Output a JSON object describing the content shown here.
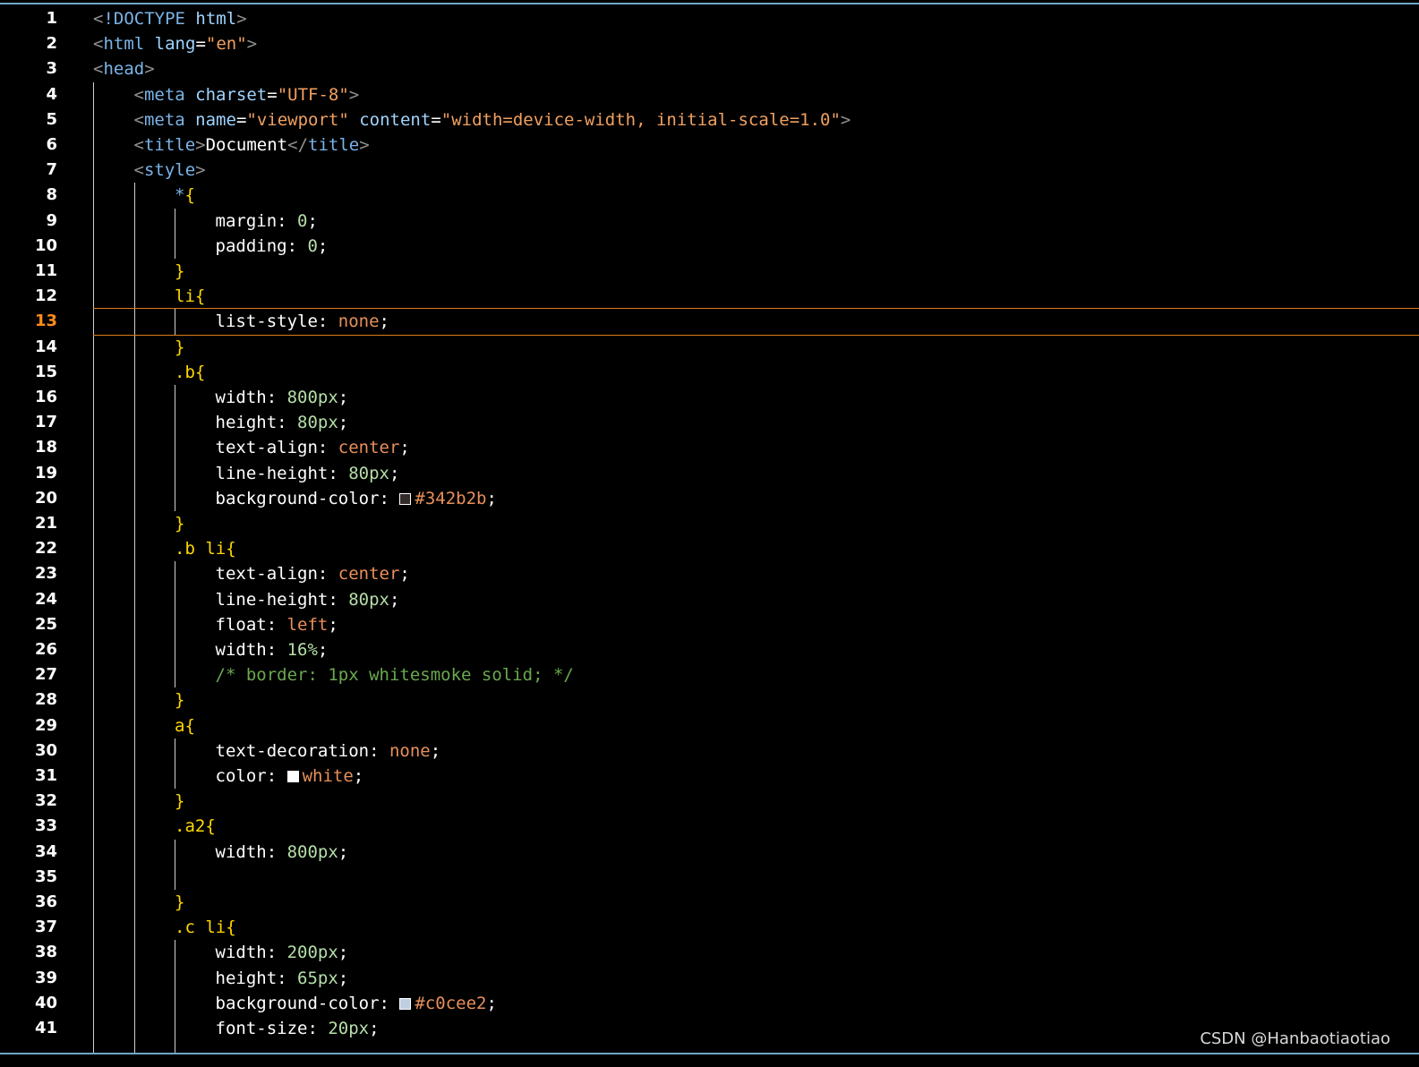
{
  "editor": {
    "active_line": 13,
    "lines": [
      {
        "n": 1,
        "indent": 0,
        "tokens": [
          [
            "bracket",
            "<"
          ],
          [
            "tag",
            "!DOCTYPE"
          ],
          [
            "text",
            " "
          ],
          [
            "attr",
            "html"
          ],
          [
            "bracket",
            ">"
          ]
        ]
      },
      {
        "n": 2,
        "indent": 0,
        "tokens": [
          [
            "bracket",
            "<"
          ],
          [
            "tag",
            "html"
          ],
          [
            "text",
            " "
          ],
          [
            "attr",
            "lang"
          ],
          [
            "punct",
            "="
          ],
          [
            "str",
            "\"en\""
          ],
          [
            "bracket",
            ">"
          ]
        ]
      },
      {
        "n": 3,
        "indent": 0,
        "tokens": [
          [
            "bracket",
            "<"
          ],
          [
            "tag",
            "head"
          ],
          [
            "bracket",
            ">"
          ]
        ]
      },
      {
        "n": 4,
        "indent": 1,
        "tokens": [
          [
            "bracket",
            "<"
          ],
          [
            "tag",
            "meta"
          ],
          [
            "text",
            " "
          ],
          [
            "attr",
            "charset"
          ],
          [
            "punct",
            "="
          ],
          [
            "str",
            "\"UTF-8\""
          ],
          [
            "bracket",
            ">"
          ]
        ]
      },
      {
        "n": 5,
        "indent": 1,
        "tokens": [
          [
            "bracket",
            "<"
          ],
          [
            "tag",
            "meta"
          ],
          [
            "text",
            " "
          ],
          [
            "attr",
            "name"
          ],
          [
            "punct",
            "="
          ],
          [
            "str",
            "\"viewport\""
          ],
          [
            "text",
            " "
          ],
          [
            "attr",
            "content"
          ],
          [
            "punct",
            "="
          ],
          [
            "str",
            "\"width=device-width, initial-scale=1.0\""
          ],
          [
            "bracket",
            ">"
          ]
        ]
      },
      {
        "n": 6,
        "indent": 1,
        "tokens": [
          [
            "bracket",
            "<"
          ],
          [
            "tag",
            "title"
          ],
          [
            "bracket",
            ">"
          ],
          [
            "text",
            "Document"
          ],
          [
            "bracket",
            "</"
          ],
          [
            "tag",
            "title"
          ],
          [
            "bracket",
            ">"
          ]
        ]
      },
      {
        "n": 7,
        "indent": 1,
        "tokens": [
          [
            "bracket",
            "<"
          ],
          [
            "tag",
            "style"
          ],
          [
            "bracket",
            ">"
          ]
        ]
      },
      {
        "n": 8,
        "indent": 2,
        "tokens": [
          [
            "tag",
            "*"
          ],
          [
            "brace",
            "{"
          ]
        ]
      },
      {
        "n": 9,
        "indent": 3,
        "tokens": [
          [
            "prop",
            "margin"
          ],
          [
            "punct",
            ": "
          ],
          [
            "num",
            "0"
          ],
          [
            "punct",
            ";"
          ]
        ]
      },
      {
        "n": 10,
        "indent": 3,
        "tokens": [
          [
            "prop",
            "padding"
          ],
          [
            "punct",
            ": "
          ],
          [
            "num",
            "0"
          ],
          [
            "punct",
            ";"
          ]
        ]
      },
      {
        "n": 11,
        "indent": 2,
        "tokens": [
          [
            "brace",
            "}"
          ]
        ]
      },
      {
        "n": 12,
        "indent": 2,
        "tokens": [
          [
            "sel",
            "li"
          ],
          [
            "brace",
            "{"
          ]
        ]
      },
      {
        "n": 13,
        "indent": 3,
        "tokens": [
          [
            "prop",
            "list-style"
          ],
          [
            "punct",
            ": "
          ],
          [
            "kw",
            "none"
          ],
          [
            "punct",
            ";"
          ]
        ]
      },
      {
        "n": 14,
        "indent": 2,
        "tokens": [
          [
            "brace",
            "}"
          ]
        ]
      },
      {
        "n": 15,
        "indent": 2,
        "tokens": [
          [
            "sel",
            ".b"
          ],
          [
            "brace",
            "{"
          ]
        ]
      },
      {
        "n": 16,
        "indent": 3,
        "tokens": [
          [
            "prop",
            "width"
          ],
          [
            "punct",
            ": "
          ],
          [
            "num",
            "800px"
          ],
          [
            "punct",
            ";"
          ]
        ]
      },
      {
        "n": 17,
        "indent": 3,
        "tokens": [
          [
            "prop",
            "height"
          ],
          [
            "punct",
            ": "
          ],
          [
            "num",
            "80px"
          ],
          [
            "punct",
            ";"
          ]
        ]
      },
      {
        "n": 18,
        "indent": 3,
        "tokens": [
          [
            "prop",
            "text-align"
          ],
          [
            "punct",
            ": "
          ],
          [
            "kw",
            "center"
          ],
          [
            "punct",
            ";"
          ]
        ]
      },
      {
        "n": 19,
        "indent": 3,
        "tokens": [
          [
            "prop",
            "line-height"
          ],
          [
            "punct",
            ": "
          ],
          [
            "num",
            "80px"
          ],
          [
            "punct",
            ";"
          ]
        ]
      },
      {
        "n": 20,
        "indent": 3,
        "tokens": [
          [
            "prop",
            "background-color"
          ],
          [
            "punct",
            ": "
          ],
          [
            "swatch",
            "#342b2b"
          ],
          [
            "kw",
            "#342b2b"
          ],
          [
            "punct",
            ";"
          ]
        ]
      },
      {
        "n": 21,
        "indent": 2,
        "tokens": [
          [
            "brace",
            "}"
          ]
        ]
      },
      {
        "n": 22,
        "indent": 2,
        "tokens": [
          [
            "sel",
            ".b li"
          ],
          [
            "brace",
            "{"
          ]
        ]
      },
      {
        "n": 23,
        "indent": 3,
        "tokens": [
          [
            "prop",
            "text-align"
          ],
          [
            "punct",
            ": "
          ],
          [
            "kw",
            "center"
          ],
          [
            "punct",
            ";"
          ]
        ]
      },
      {
        "n": 24,
        "indent": 3,
        "tokens": [
          [
            "prop",
            "line-height"
          ],
          [
            "punct",
            ": "
          ],
          [
            "num",
            "80px"
          ],
          [
            "punct",
            ";"
          ]
        ]
      },
      {
        "n": 25,
        "indent": 3,
        "tokens": [
          [
            "prop",
            "float"
          ],
          [
            "punct",
            ": "
          ],
          [
            "kw",
            "left"
          ],
          [
            "punct",
            ";"
          ]
        ]
      },
      {
        "n": 26,
        "indent": 3,
        "tokens": [
          [
            "prop",
            "width"
          ],
          [
            "punct",
            ": "
          ],
          [
            "num",
            "16%"
          ],
          [
            "punct",
            ";"
          ]
        ]
      },
      {
        "n": 27,
        "indent": 3,
        "tokens": [
          [
            "comment",
            "/* border: 1px whitesmoke solid; */"
          ]
        ]
      },
      {
        "n": 28,
        "indent": 2,
        "tokens": [
          [
            "brace",
            "}"
          ]
        ]
      },
      {
        "n": 29,
        "indent": 2,
        "tokens": [
          [
            "sel",
            "a"
          ],
          [
            "brace",
            "{"
          ]
        ]
      },
      {
        "n": 30,
        "indent": 3,
        "tokens": [
          [
            "prop",
            "text-decoration"
          ],
          [
            "punct",
            ": "
          ],
          [
            "kw",
            "none"
          ],
          [
            "punct",
            ";"
          ]
        ]
      },
      {
        "n": 31,
        "indent": 3,
        "tokens": [
          [
            "prop",
            "color"
          ],
          [
            "punct",
            ": "
          ],
          [
            "swatch",
            "#ffffff"
          ],
          [
            "kw",
            "white"
          ],
          [
            "punct",
            ";"
          ]
        ]
      },
      {
        "n": 32,
        "indent": 2,
        "tokens": [
          [
            "brace",
            "}"
          ]
        ]
      },
      {
        "n": 33,
        "indent": 2,
        "tokens": [
          [
            "sel",
            ".a2"
          ],
          [
            "brace",
            "{"
          ]
        ]
      },
      {
        "n": 34,
        "indent": 3,
        "tokens": [
          [
            "prop",
            "width"
          ],
          [
            "punct",
            ": "
          ],
          [
            "num",
            "800px"
          ],
          [
            "punct",
            ";"
          ]
        ]
      },
      {
        "n": 35,
        "indent": 3,
        "tokens": []
      },
      {
        "n": 36,
        "indent": 2,
        "tokens": [
          [
            "brace",
            "}"
          ]
        ]
      },
      {
        "n": 37,
        "indent": 2,
        "tokens": [
          [
            "sel",
            ".c li"
          ],
          [
            "brace",
            "{"
          ]
        ]
      },
      {
        "n": 38,
        "indent": 3,
        "tokens": [
          [
            "prop",
            "width"
          ],
          [
            "punct",
            ": "
          ],
          [
            "num",
            "200px"
          ],
          [
            "punct",
            ";"
          ]
        ]
      },
      {
        "n": 39,
        "indent": 3,
        "tokens": [
          [
            "prop",
            "height"
          ],
          [
            "punct",
            ": "
          ],
          [
            "num",
            "65px"
          ],
          [
            "punct",
            ";"
          ]
        ]
      },
      {
        "n": 40,
        "indent": 3,
        "tokens": [
          [
            "prop",
            "background-color"
          ],
          [
            "punct",
            ": "
          ],
          [
            "swatch",
            "#c0cee2"
          ],
          [
            "kw",
            "#c0cee2"
          ],
          [
            "punct",
            ";"
          ]
        ]
      },
      {
        "n": 41,
        "indent": 3,
        "tokens": [
          [
            "prop",
            "font-size"
          ],
          [
            "punct",
            ": "
          ],
          [
            "num",
            "20px"
          ],
          [
            "punct",
            ";"
          ]
        ]
      }
    ]
  },
  "watermark": "CSDN @Hanbaotiaotiao"
}
